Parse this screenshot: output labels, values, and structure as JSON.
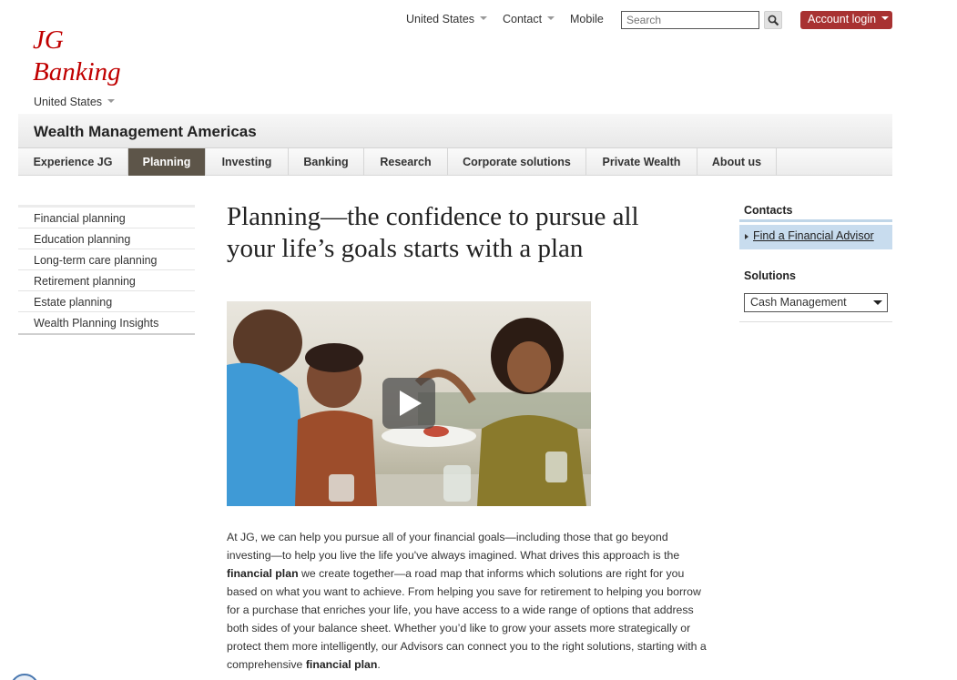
{
  "utility_bar": {
    "region_label": "United States",
    "contact_label": "Contact",
    "mobile_label": "Mobile",
    "search_placeholder": "Search",
    "login_label": "Account login"
  },
  "logo": {
    "line1": "JG",
    "line2": "Banking"
  },
  "country_selector": "United States",
  "section_title": "Wealth Management Americas",
  "main_nav": [
    {
      "label": "Experience JG",
      "active": false
    },
    {
      "label": "Planning",
      "active": true
    },
    {
      "label": "Investing",
      "active": false
    },
    {
      "label": "Banking",
      "active": false
    },
    {
      "label": "Research",
      "active": false
    },
    {
      "label": "Corporate solutions",
      "active": false
    },
    {
      "label": "Private Wealth",
      "active": false
    },
    {
      "label": "About us",
      "active": false
    }
  ],
  "sidebar": {
    "items": [
      {
        "label": "Financial planning"
      },
      {
        "label": "Education planning"
      },
      {
        "label": "Long-term care planning"
      },
      {
        "label": "Retirement planning"
      },
      {
        "label": "Estate planning"
      },
      {
        "label": "Wealth Planning Insights"
      }
    ]
  },
  "main": {
    "headline": "Planning—the confidence to pursue all your life’s goals starts with a plan",
    "body": {
      "part1": "At JG, we can help you pursue all of your financial goals—including those that go beyond investing—to help you live the life you've always imagined. What drives this approach is the ",
      "bold1": "financial plan",
      "part2": " we create together—a road map that informs which solutions are right for you based on what you want to achieve. From helping you save for retirement to helping you borrow for a purchase that enriches your life, you have access to a wide range of options that address both sides of your balance sheet. Whether you’d like to grow your assets more strategically or protect them more intelligently, our Advisors can connect you to the right solutions, starting with a comprehensive ",
      "bold2": "financial plan",
      "part3": "."
    }
  },
  "right_column": {
    "contacts_title": "Contacts",
    "advisor_link": "Find a Financial Advisor",
    "solutions_title": "Solutions",
    "solutions_selected": "Cash Management"
  },
  "colors": {
    "brand_red": "#c00000",
    "login_button": "#a83232",
    "active_nav": "#5d5549",
    "contact_highlight": "#c8dcee"
  },
  "icons": [
    "search-icon",
    "play-icon",
    "chevron-down-icon"
  ]
}
